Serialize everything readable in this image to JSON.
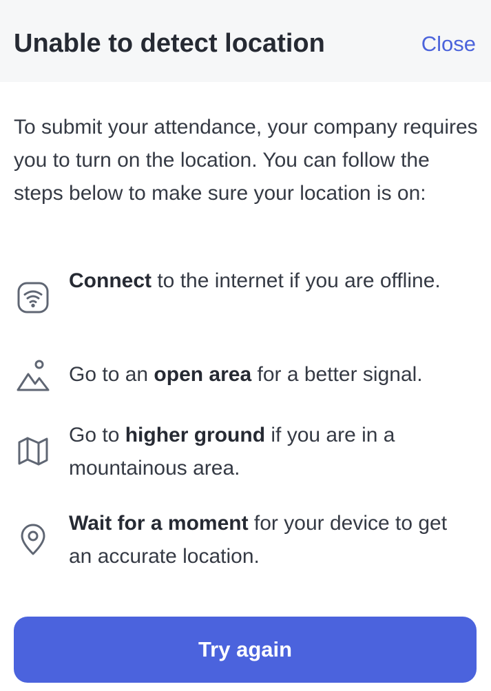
{
  "header": {
    "title": "Unable to detect location",
    "close_label": "Close"
  },
  "intro": "To submit your attendance, your company requires you to turn on the location. You can follow the steps below to make sure your location is on:",
  "steps": [
    {
      "icon": "wifi-icon",
      "bold": "Connect",
      "before": "",
      "after": " to the internet if you are offline."
    },
    {
      "icon": "mountain-icon",
      "bold": "open area",
      "before": "Go to an ",
      "after": " for a better signal."
    },
    {
      "icon": "map-icon",
      "bold": "higher ground",
      "before": "Go to ",
      "after": " if you are in a mountainous area."
    },
    {
      "icon": "location-pin-icon",
      "bold": "Wait for a moment",
      "before": "",
      "after": " for your device to get an accurate location."
    }
  ],
  "action": {
    "try_again_label": "Try again"
  },
  "colors": {
    "accent": "#4b63dd",
    "text": "#353a44",
    "header_bg": "#f6f7f8",
    "icon": "#5f6673"
  }
}
